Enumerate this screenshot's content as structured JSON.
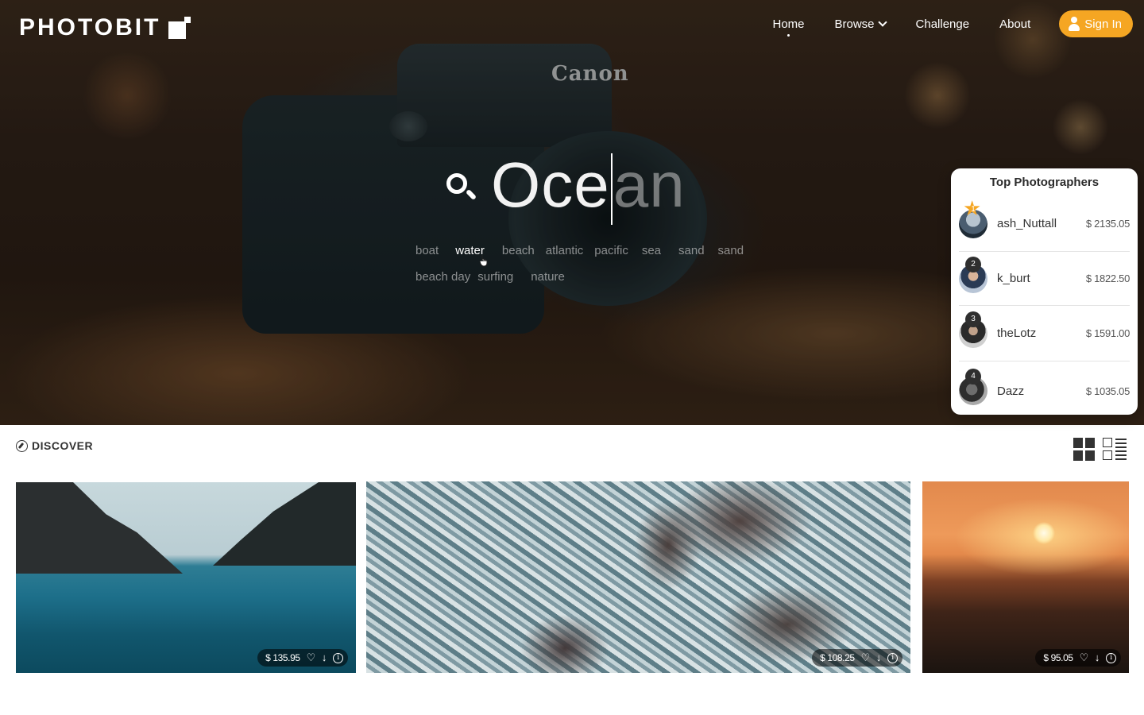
{
  "brand": {
    "name": "PHOTOBIT",
    "icon": "photobit-logo-mark"
  },
  "nav": {
    "items": [
      {
        "label": "Home",
        "active": true
      },
      {
        "label": "Browse",
        "has_dropdown": true
      },
      {
        "label": "Challenge"
      },
      {
        "label": "About"
      }
    ],
    "sign_in_label": "Sign In",
    "accent": "#f5a623"
  },
  "hero": {
    "camera_brand": "Canon",
    "search": {
      "typed": "Oce",
      "completion": "an",
      "icon": "search-icon"
    },
    "suggestions": [
      "boat",
      "water",
      "beach",
      "atlantic",
      "pacific",
      "sea",
      "sand",
      "sand",
      "beach day",
      "surfing",
      "nature"
    ],
    "active_suggestion": "water"
  },
  "top_photographers": {
    "title": "Top Photographers",
    "entries": [
      {
        "rank": "1",
        "name": "ash_Nuttall",
        "amount": "$ 2135.05"
      },
      {
        "rank": "2",
        "name": "k_burt",
        "amount": "$ 1822.50"
      },
      {
        "rank": "3",
        "name": "theLotz",
        "amount": "$ 1591.00"
      },
      {
        "rank": "4",
        "name": "Dazz",
        "amount": "$ 1035.05"
      }
    ]
  },
  "discover": {
    "label": "DISCOVER",
    "icon": "compass-icon",
    "view_modes": [
      "grid-view-icon",
      "list-view-icon"
    ],
    "photos": [
      {
        "price": "$ 135.95"
      },
      {
        "price": "$ 108.25"
      },
      {
        "price": "$ 95.05"
      }
    ]
  }
}
